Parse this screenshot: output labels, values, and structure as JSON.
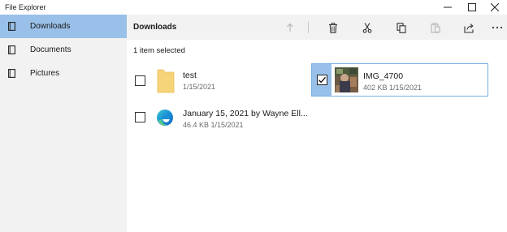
{
  "window": {
    "title": "File Explorer"
  },
  "sidebar": {
    "items": [
      {
        "label": "Downloads",
        "icon": "document-icon",
        "selected": true
      },
      {
        "label": "Documents",
        "icon": "document-icon",
        "selected": false
      },
      {
        "label": "Pictures",
        "icon": "document-icon",
        "selected": false
      }
    ]
  },
  "toolbar": {
    "folder_title": "Downloads",
    "buttons": [
      "up-arrow-icon",
      "delete-icon",
      "cut-icon",
      "copy-icon",
      "paste-icon",
      "share-icon",
      "more-icon"
    ]
  },
  "content": {
    "status": "1 item selected",
    "files": [
      {
        "name": "test",
        "meta": "1/15/2021",
        "icon": "folder-icon",
        "checked": false
      },
      {
        "name": "IMG_4700",
        "meta": "402 KB 1/15/2021",
        "icon": "image-thumbnail",
        "checked": true
      },
      {
        "name": "January 15, 2021 by Wayne Ell...",
        "meta": "46.4 KB 1/15/2021",
        "icon": "edge-browser-icon",
        "checked": false
      }
    ]
  },
  "colors": {
    "selection": "#99c0e8",
    "selection_border": "#7ab0e6",
    "sidebar_bg": "#f2f2f2",
    "folder": "#f6d47a"
  }
}
